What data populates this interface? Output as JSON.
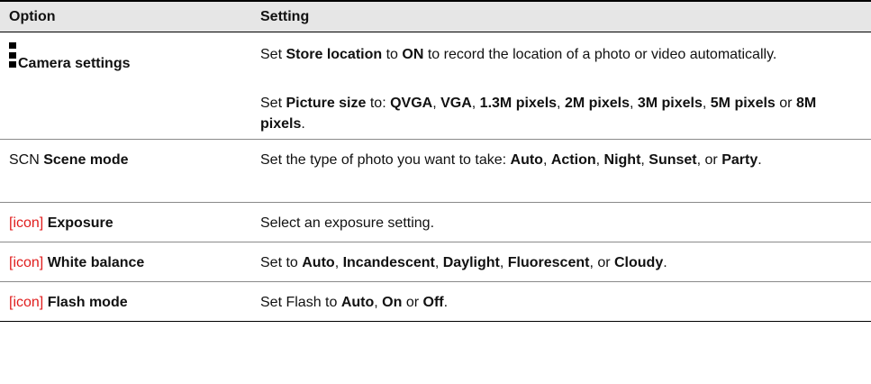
{
  "header": {
    "option": "Option",
    "setting": "Setting"
  },
  "camera": {
    "icon": "bar-icon",
    "name": "Camera settings",
    "p1": {
      "t1": "Set ",
      "b1": "Store location",
      "t2": " to ",
      "b2": "ON",
      "t3": " to record the location of a photo or video automatically."
    },
    "p2": {
      "t1": "Set ",
      "b1": "Picture size",
      "t2": " to: ",
      "b2": "QVGA",
      "s2": ", ",
      "b3": "VGA",
      "s3": ", ",
      "b4": "1.3M pixels",
      "s4": ", ",
      "b5": "2M pixels",
      "s5": ", ",
      "b6": "3M pixels",
      "s6": ", ",
      "b7": "5M pixels",
      "s7": " or ",
      "b8": "8M pixels",
      "s8": "."
    }
  },
  "scene": {
    "prefix": "SCN ",
    "name": "Scene mode",
    "t1": "Set the type of photo you want to take: ",
    "b1": "Auto",
    "s1": ", ",
    "b2": "Action",
    "s2": ", ",
    "b3": "Night",
    "s3": ", ",
    "b4": "Sunset",
    "s4": ", or ",
    "b5": "Party",
    "s5": "."
  },
  "exposure": {
    "icon_text": "[icon]",
    "name": "Exposure",
    "text": "Select an exposure setting."
  },
  "white_balance": {
    "icon_text": "[icon]",
    "name": "White balance",
    "t1": "Set to ",
    "b1": "Auto",
    "s1": ", ",
    "b2": "Incandescent",
    "s2": ", ",
    "b3": "Daylight",
    "s3": ", ",
    "b4": "Fluorescent",
    "s4": ", or ",
    "b5": "Cloudy",
    "s5": "."
  },
  "flash": {
    "icon_text": "[icon]",
    "name": "Flash mode",
    "t1": "Set Flash to ",
    "b1": "Auto",
    "s1": ", ",
    "b2": "On",
    "s2": " or ",
    "b3": "Off",
    "s3": "."
  },
  "colors": {
    "header_bg": "#e6e6e6",
    "icon_placeholder": "#e01d1d",
    "rule": "#8a8a8a"
  }
}
